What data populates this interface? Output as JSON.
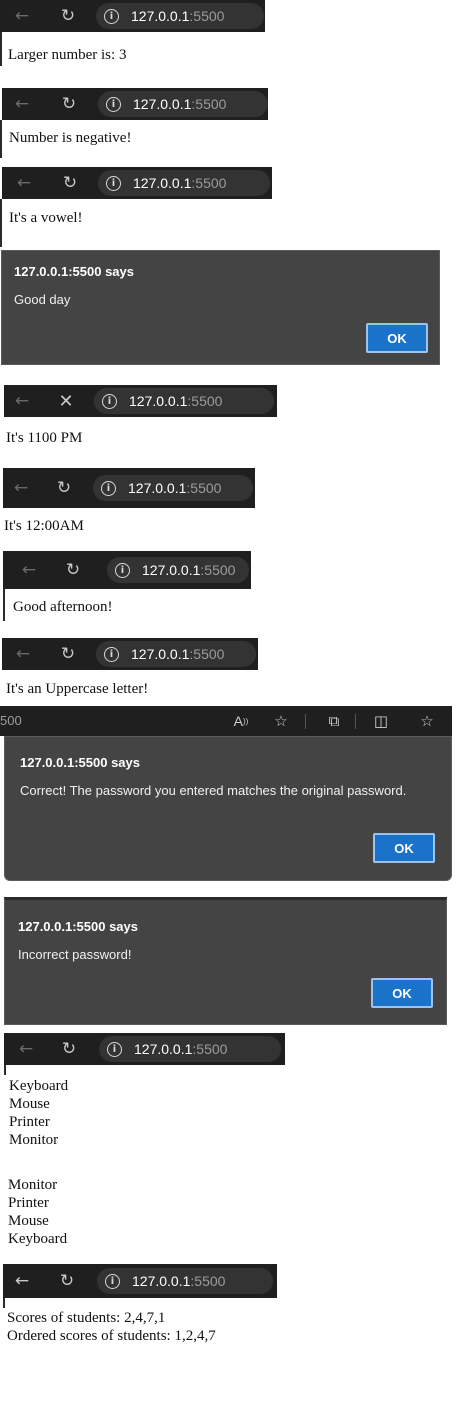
{
  "browser": {
    "host": "127.0.0.1",
    "port_suffix": ":5500",
    "partial_port": "500"
  },
  "outputs": {
    "larger_number": "Larger number is: 3",
    "negative": "Number is negative!",
    "vowel": "It's a vowel!",
    "time_1100": "It's 1100 PM",
    "time_1200": "It's 12:00AM",
    "afternoon": "Good afternoon!",
    "uppercase": "It's an Uppercase letter!",
    "devices": [
      "Keyboard",
      "Mouse",
      "Printer",
      "Monitor"
    ],
    "devices_reversed": [
      "Monitor",
      "Printer",
      "Mouse",
      "Keyboard"
    ],
    "scores": "Scores of students: 2,4,7,1",
    "ordered_scores": "Ordered scores of students: 1,2,4,7"
  },
  "dialogs": {
    "title": "127.0.0.1:5500 says",
    "good_day": "Good day",
    "correct": "Correct! The password you entered matches the original password.",
    "incorrect": "Incorrect password!",
    "ok_label": "OK"
  },
  "icons": {
    "back": "back-arrow-icon",
    "reload": "reload-icon",
    "stop": "stop-x-icon",
    "info": "info-icon",
    "read_aloud": "read-aloud-icon",
    "favorite": "star-icon",
    "extensions": "puzzle-icon",
    "split_screen": "split-screen-icon",
    "favorites_list": "favorites-list-icon"
  }
}
